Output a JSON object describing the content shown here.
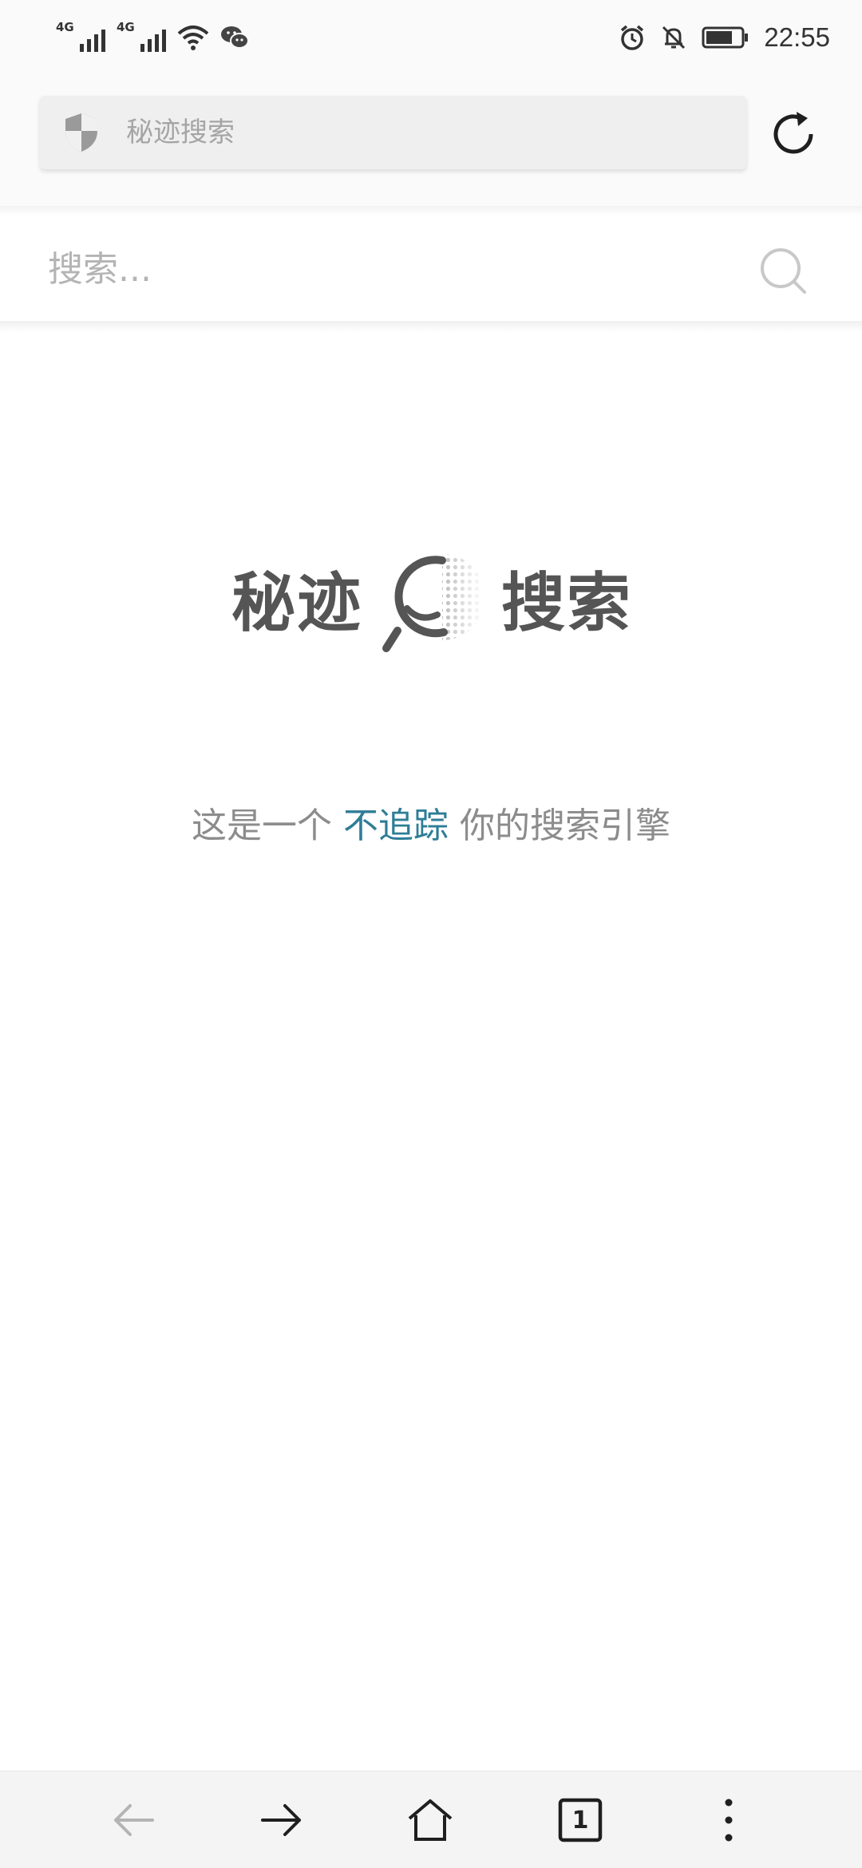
{
  "status_bar": {
    "network_left": "4G",
    "network_right": "4G",
    "time": "22:55",
    "icons": [
      "signal-icon",
      "signal-icon",
      "wifi-icon",
      "wechat-icon",
      "alarm-icon",
      "mute-bell-icon",
      "battery-icon"
    ]
  },
  "address_bar": {
    "placeholder": "秘迹搜索",
    "icons": [
      "shield-icon",
      "reload-icon"
    ]
  },
  "page_search": {
    "placeholder": "搜索...",
    "icon": "search-icon"
  },
  "logo": {
    "left_text": "秘迹",
    "right_text": "搜索"
  },
  "tagline": {
    "before": "这是一个",
    "highlight": "不追踪",
    "after": "你的搜索引擎",
    "highlight_color": "#2e7d96"
  },
  "bottom_nav": {
    "tab_count": "1",
    "items": [
      "back-icon",
      "forward-icon",
      "home-icon",
      "tabs-icon",
      "menu-icon"
    ]
  }
}
